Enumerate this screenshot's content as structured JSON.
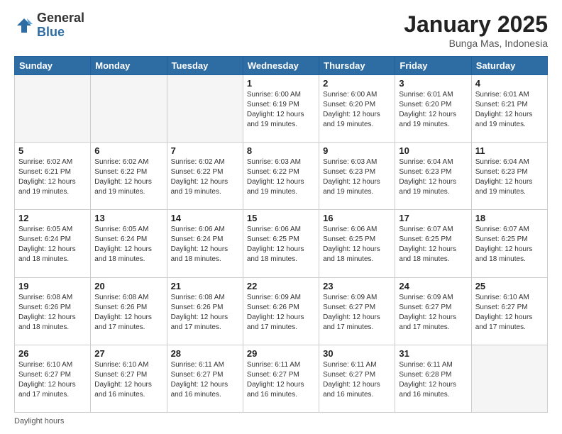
{
  "header": {
    "logo_general": "General",
    "logo_blue": "Blue",
    "month_title": "January 2025",
    "location": "Bunga Mas, Indonesia"
  },
  "days_of_week": [
    "Sunday",
    "Monday",
    "Tuesday",
    "Wednesday",
    "Thursday",
    "Friday",
    "Saturday"
  ],
  "weeks": [
    [
      {
        "day": "",
        "info": ""
      },
      {
        "day": "",
        "info": ""
      },
      {
        "day": "",
        "info": ""
      },
      {
        "day": "1",
        "info": "Sunrise: 6:00 AM\nSunset: 6:19 PM\nDaylight: 12 hours\nand 19 minutes."
      },
      {
        "day": "2",
        "info": "Sunrise: 6:00 AM\nSunset: 6:20 PM\nDaylight: 12 hours\nand 19 minutes."
      },
      {
        "day": "3",
        "info": "Sunrise: 6:01 AM\nSunset: 6:20 PM\nDaylight: 12 hours\nand 19 minutes."
      },
      {
        "day": "4",
        "info": "Sunrise: 6:01 AM\nSunset: 6:21 PM\nDaylight: 12 hours\nand 19 minutes."
      }
    ],
    [
      {
        "day": "5",
        "info": "Sunrise: 6:02 AM\nSunset: 6:21 PM\nDaylight: 12 hours\nand 19 minutes."
      },
      {
        "day": "6",
        "info": "Sunrise: 6:02 AM\nSunset: 6:22 PM\nDaylight: 12 hours\nand 19 minutes."
      },
      {
        "day": "7",
        "info": "Sunrise: 6:02 AM\nSunset: 6:22 PM\nDaylight: 12 hours\nand 19 minutes."
      },
      {
        "day": "8",
        "info": "Sunrise: 6:03 AM\nSunset: 6:22 PM\nDaylight: 12 hours\nand 19 minutes."
      },
      {
        "day": "9",
        "info": "Sunrise: 6:03 AM\nSunset: 6:23 PM\nDaylight: 12 hours\nand 19 minutes."
      },
      {
        "day": "10",
        "info": "Sunrise: 6:04 AM\nSunset: 6:23 PM\nDaylight: 12 hours\nand 19 minutes."
      },
      {
        "day": "11",
        "info": "Sunrise: 6:04 AM\nSunset: 6:23 PM\nDaylight: 12 hours\nand 19 minutes."
      }
    ],
    [
      {
        "day": "12",
        "info": "Sunrise: 6:05 AM\nSunset: 6:24 PM\nDaylight: 12 hours\nand 18 minutes."
      },
      {
        "day": "13",
        "info": "Sunrise: 6:05 AM\nSunset: 6:24 PM\nDaylight: 12 hours\nand 18 minutes."
      },
      {
        "day": "14",
        "info": "Sunrise: 6:06 AM\nSunset: 6:24 PM\nDaylight: 12 hours\nand 18 minutes."
      },
      {
        "day": "15",
        "info": "Sunrise: 6:06 AM\nSunset: 6:25 PM\nDaylight: 12 hours\nand 18 minutes."
      },
      {
        "day": "16",
        "info": "Sunrise: 6:06 AM\nSunset: 6:25 PM\nDaylight: 12 hours\nand 18 minutes."
      },
      {
        "day": "17",
        "info": "Sunrise: 6:07 AM\nSunset: 6:25 PM\nDaylight: 12 hours\nand 18 minutes."
      },
      {
        "day": "18",
        "info": "Sunrise: 6:07 AM\nSunset: 6:25 PM\nDaylight: 12 hours\nand 18 minutes."
      }
    ],
    [
      {
        "day": "19",
        "info": "Sunrise: 6:08 AM\nSunset: 6:26 PM\nDaylight: 12 hours\nand 18 minutes."
      },
      {
        "day": "20",
        "info": "Sunrise: 6:08 AM\nSunset: 6:26 PM\nDaylight: 12 hours\nand 17 minutes."
      },
      {
        "day": "21",
        "info": "Sunrise: 6:08 AM\nSunset: 6:26 PM\nDaylight: 12 hours\nand 17 minutes."
      },
      {
        "day": "22",
        "info": "Sunrise: 6:09 AM\nSunset: 6:26 PM\nDaylight: 12 hours\nand 17 minutes."
      },
      {
        "day": "23",
        "info": "Sunrise: 6:09 AM\nSunset: 6:27 PM\nDaylight: 12 hours\nand 17 minutes."
      },
      {
        "day": "24",
        "info": "Sunrise: 6:09 AM\nSunset: 6:27 PM\nDaylight: 12 hours\nand 17 minutes."
      },
      {
        "day": "25",
        "info": "Sunrise: 6:10 AM\nSunset: 6:27 PM\nDaylight: 12 hours\nand 17 minutes."
      }
    ],
    [
      {
        "day": "26",
        "info": "Sunrise: 6:10 AM\nSunset: 6:27 PM\nDaylight: 12 hours\nand 17 minutes."
      },
      {
        "day": "27",
        "info": "Sunrise: 6:10 AM\nSunset: 6:27 PM\nDaylight: 12 hours\nand 16 minutes."
      },
      {
        "day": "28",
        "info": "Sunrise: 6:11 AM\nSunset: 6:27 PM\nDaylight: 12 hours\nand 16 minutes."
      },
      {
        "day": "29",
        "info": "Sunrise: 6:11 AM\nSunset: 6:27 PM\nDaylight: 12 hours\nand 16 minutes."
      },
      {
        "day": "30",
        "info": "Sunrise: 6:11 AM\nSunset: 6:27 PM\nDaylight: 12 hours\nand 16 minutes."
      },
      {
        "day": "31",
        "info": "Sunrise: 6:11 AM\nSunset: 6:28 PM\nDaylight: 12 hours\nand 16 minutes."
      },
      {
        "day": "",
        "info": ""
      }
    ]
  ],
  "footer": {
    "note": "Daylight hours"
  }
}
